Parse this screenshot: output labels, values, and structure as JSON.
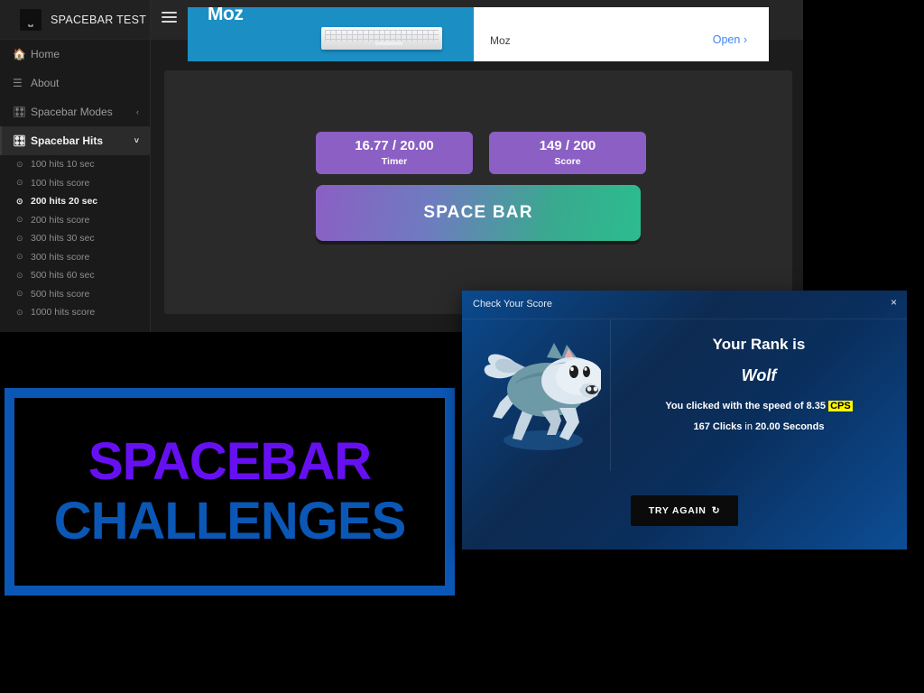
{
  "brand": {
    "logo_icon": "spacebar-glyph",
    "title": "SPACEBAR TEST"
  },
  "topbar": {
    "menu_icon": "hamburger-icon"
  },
  "ad": {
    "brand": "Moz",
    "visual_icon": "keyboard-image",
    "info_title": "Moz",
    "open_label": "Open",
    "open_chevron": "›"
  },
  "sidebar": {
    "items": [
      {
        "label": "Home",
        "icon": "home-icon",
        "chevron": "",
        "active": false
      },
      {
        "label": "About",
        "icon": "list-icon",
        "chevron": "",
        "active": false
      },
      {
        "label": "Spacebar Modes",
        "icon": "sliders-icon",
        "chevron": "‹",
        "active": false
      },
      {
        "label": "Spacebar Hits",
        "icon": "sliders-icon",
        "chevron": "˅",
        "active": true
      }
    ],
    "sub_items": [
      {
        "label": "100 hits 10 sec",
        "active": false
      },
      {
        "label": "100 hits score",
        "active": false
      },
      {
        "label": "200 hits 20 sec",
        "active": true
      },
      {
        "label": "200 hits score",
        "active": false
      },
      {
        "label": "300 hits 30 sec",
        "active": false
      },
      {
        "label": "300 hits score",
        "active": false
      },
      {
        "label": "500 hits 60 sec",
        "active": false
      },
      {
        "label": "500 hits score",
        "active": false
      },
      {
        "label": "1000 hits score",
        "active": false
      }
    ],
    "sub_dot_icon": "⊙"
  },
  "game": {
    "timer": {
      "value": "16.77 / 20.00",
      "label": "Timer"
    },
    "score": {
      "value": "149 / 200",
      "label": "Score"
    },
    "spacebar_label": "SPACE BAR"
  },
  "banner": {
    "line1": "SPACEBAR",
    "line2": "CHALLENGES"
  },
  "modal": {
    "title": "Check Your Score",
    "close_icon": "×",
    "illustration": "running-wolf",
    "rank_heading": "Your Rank is",
    "rank_value": "Wolf",
    "speed_prefix": "You clicked with the speed of 8.35",
    "cps_badge": "CPS",
    "clicks_count": "167",
    "clicks_word": "Clicks",
    "in_word": "in",
    "seconds_value": "20.00",
    "seconds_word": "Seconds",
    "try_again_label": "TRY AGAIN",
    "try_again_icon": "↻"
  },
  "colors": {
    "accent_purple": "#8b5fc4",
    "accent_teal": "#2bbd8e",
    "banner_blue": "#0b57b5",
    "banner_purple": "#6610f2",
    "cps_yellow": "#fff600",
    "ad_blue": "#1b8fc4",
    "link_blue": "#4285f4"
  }
}
